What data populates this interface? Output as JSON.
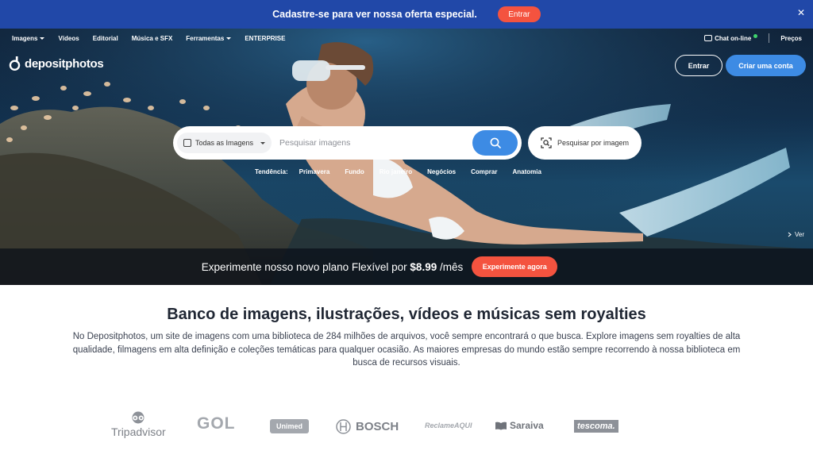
{
  "promo": {
    "text": "Cadastre-se para ver nossa oferta especial.",
    "button": "Entrar",
    "close": "✕"
  },
  "nav": {
    "items": [
      {
        "label": "Imagens",
        "dropdown": true
      },
      {
        "label": "Vídeos",
        "dropdown": false
      },
      {
        "label": "Editorial",
        "dropdown": false
      },
      {
        "label": "Música e SFX",
        "dropdown": false
      },
      {
        "label": "Ferramentas",
        "dropdown": true
      },
      {
        "label": "ENTERPRISE",
        "dropdown": false
      }
    ],
    "chat": "Chat on-line",
    "pricing": "Preços"
  },
  "brand": {
    "name": "depositphotos"
  },
  "auth": {
    "login": "Entrar",
    "signup": "Criar uma conta"
  },
  "search": {
    "type": "Todas as Imagens",
    "placeholder": "Pesquisar imagens",
    "visual": "Pesquisar por imagem"
  },
  "trending": {
    "label": "Tendência:",
    "items": [
      "Primavera",
      "Fundo",
      "Rio janeiro",
      "Negócios",
      "Comprar",
      "Anatomia"
    ]
  },
  "hero": {
    "more": "Ver"
  },
  "offer": {
    "text": "Experimente nosso novo plano Flexível por",
    "price": "$8.99",
    "period": "/mês",
    "button": "Experimente agora"
  },
  "content": {
    "title": "Banco de imagens, ilustrações, vídeos e músicas sem royalties",
    "description": "No Depositphotos, um site de imagens com uma biblioteca de 284 milhões de arquivos, você sempre encontrará o que busca. Explore imagens sem royalties de alta qualidade, filmagens em alta definição e coleções temáticas para qualquer ocasião. As maiores empresas do mundo estão sempre recorrendo à nossa biblioteca em busca de recursos visuais."
  },
  "clients": [
    "Tripadvisor",
    "GOL",
    "Unimed",
    "BOSCH",
    "ReclameAQUI",
    "Saraiva",
    "tescoma."
  ],
  "colors": {
    "promo_bar": "#2148a8",
    "accent_blue": "#3d8be4",
    "accent_red": "#f4533f"
  }
}
